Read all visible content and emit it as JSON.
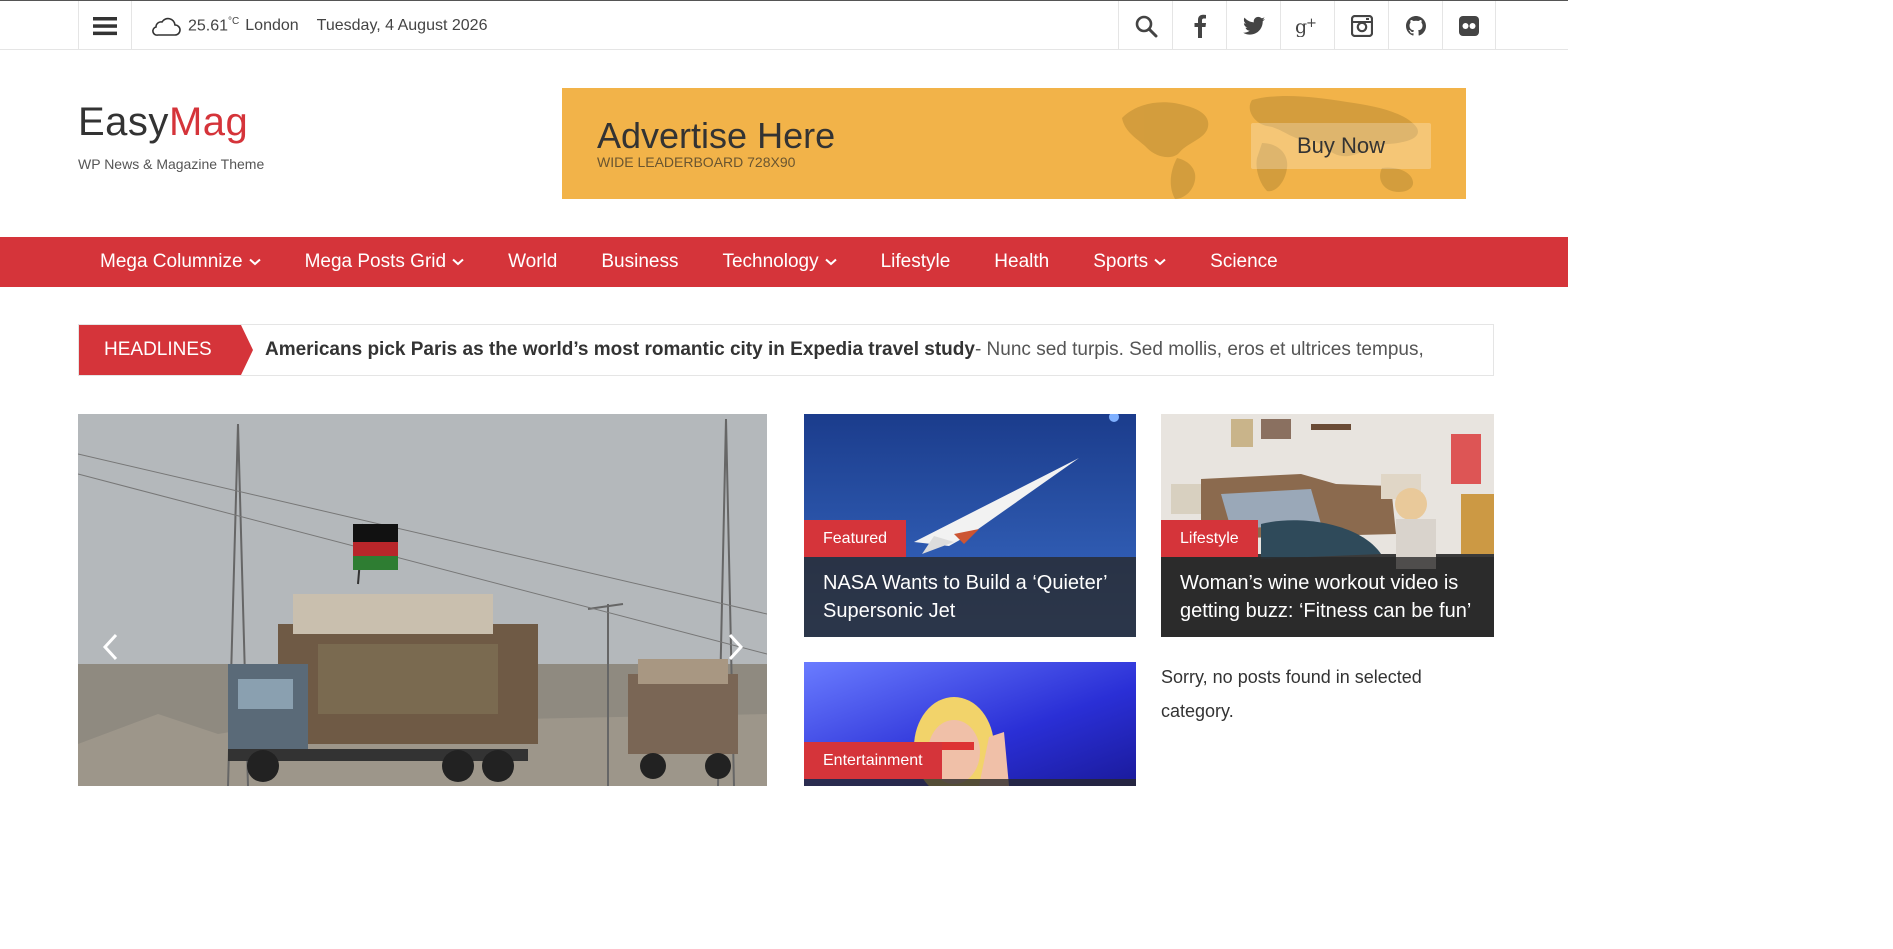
{
  "topbar": {
    "temperature": "25.61",
    "unit": "°C",
    "city": "London",
    "date": "Tuesday, 4 August 2026",
    "icons": [
      "menu-icon",
      "cloud-icon",
      "search-icon",
      "facebook-icon",
      "twitter-icon",
      "google-plus-icon",
      "instagram-icon",
      "github-icon",
      "flickr-icon"
    ]
  },
  "logo": {
    "part1": "Easy",
    "part2": "Mag",
    "tagline": "WP News & Magazine Theme"
  },
  "ad": {
    "title": "Advertise Here",
    "subtitle": "WIDE LEADERBOARD 728X90",
    "button": "Buy Now"
  },
  "nav": {
    "items": [
      {
        "label": "Mega Columnize"
      },
      {
        "label": "Mega Posts Grid"
      },
      {
        "label": "World"
      },
      {
        "label": "Business"
      },
      {
        "label": "Technology"
      },
      {
        "label": "Lifestyle"
      },
      {
        "label": "Health"
      },
      {
        "label": "Sports"
      },
      {
        "label": "Science"
      }
    ]
  },
  "ticker": {
    "label": "HEADLINES",
    "headline": "Americans pick Paris as the world’s most romantic city in Expedia travel study",
    "excerpt": " - Nunc sed turpis. Sed mollis, eros et ultrices tempus,"
  },
  "cards": [
    {
      "category": "Featured",
      "title": "NASA Wants to Build a ‘Quieter’ Supersonic Jet"
    },
    {
      "category": "Lifestyle",
      "title": "Woman’s wine workout video is getting buzz: ‘Fitness can be fun’"
    },
    {
      "category": "Entertainment",
      "title": ""
    }
  ],
  "no_posts": "Sorry, no posts found in selected category.",
  "colors": {
    "accent": "#d5343a",
    "ad_background": "#f2b349"
  }
}
